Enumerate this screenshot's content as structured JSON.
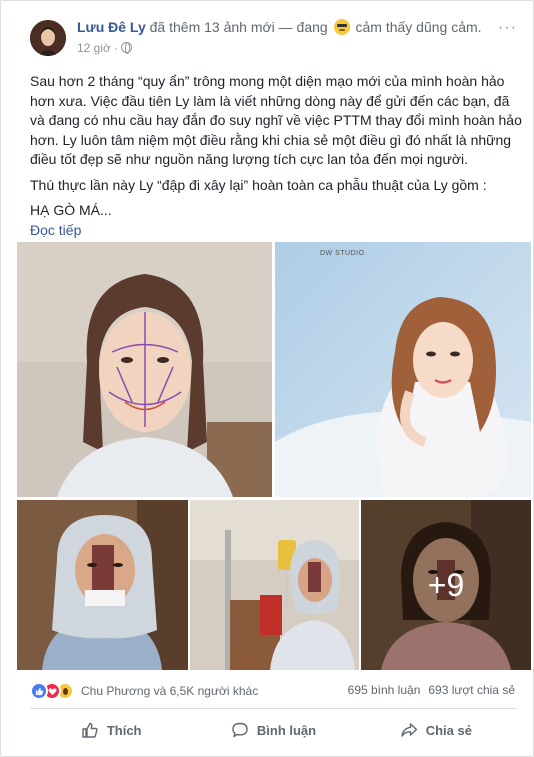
{
  "post": {
    "author": "Lưu Đê Ly",
    "action_before": "đã thêm 13 ảnh mới — đang",
    "action_after": "cảm thấy dũng cảm.",
    "feeling_icon": "cool-emoji",
    "time": "12 giờ",
    "privacy_icon": "globe-icon",
    "paragraphs": [
      "Sau hơn 2 tháng “quy ẩn” trông mong một diện mạo mới của mình hoàn hảo hơn xưa. Việc đầu tiên Ly làm là viết những dòng này để gửi đến các bạn, đã và đang có nhu cầu hay đắn đo suy nghĩ về việc PTTM thay đổi mình hoàn hảo hơn. Ly luôn tâm niệm một điều rằng khi chia sẻ một điều gì đó nhất là những điều tốt đẹp sẽ như nguồn năng lượng tích cực lan tỏa đến mọi người.",
      "Thú thực lần này Ly “đập đi xây lại” hoàn toàn ca phẫu thuật của Ly gồm :",
      "HẠ GÒ MÁ..."
    ],
    "see_more": "Đọc tiếp",
    "photos": {
      "studio_mark": "DW STUDIO",
      "more_count": "+9"
    },
    "reactions": {
      "icons": [
        "like",
        "love",
        "wow"
      ],
      "names": "Chu Phương và 6,5K người khác",
      "comments": "695 bình luận",
      "shares": "693 lượt chia sẻ"
    },
    "buttons": {
      "like": "Thích",
      "comment": "Bình luận",
      "share": "Chia sẻ"
    }
  }
}
